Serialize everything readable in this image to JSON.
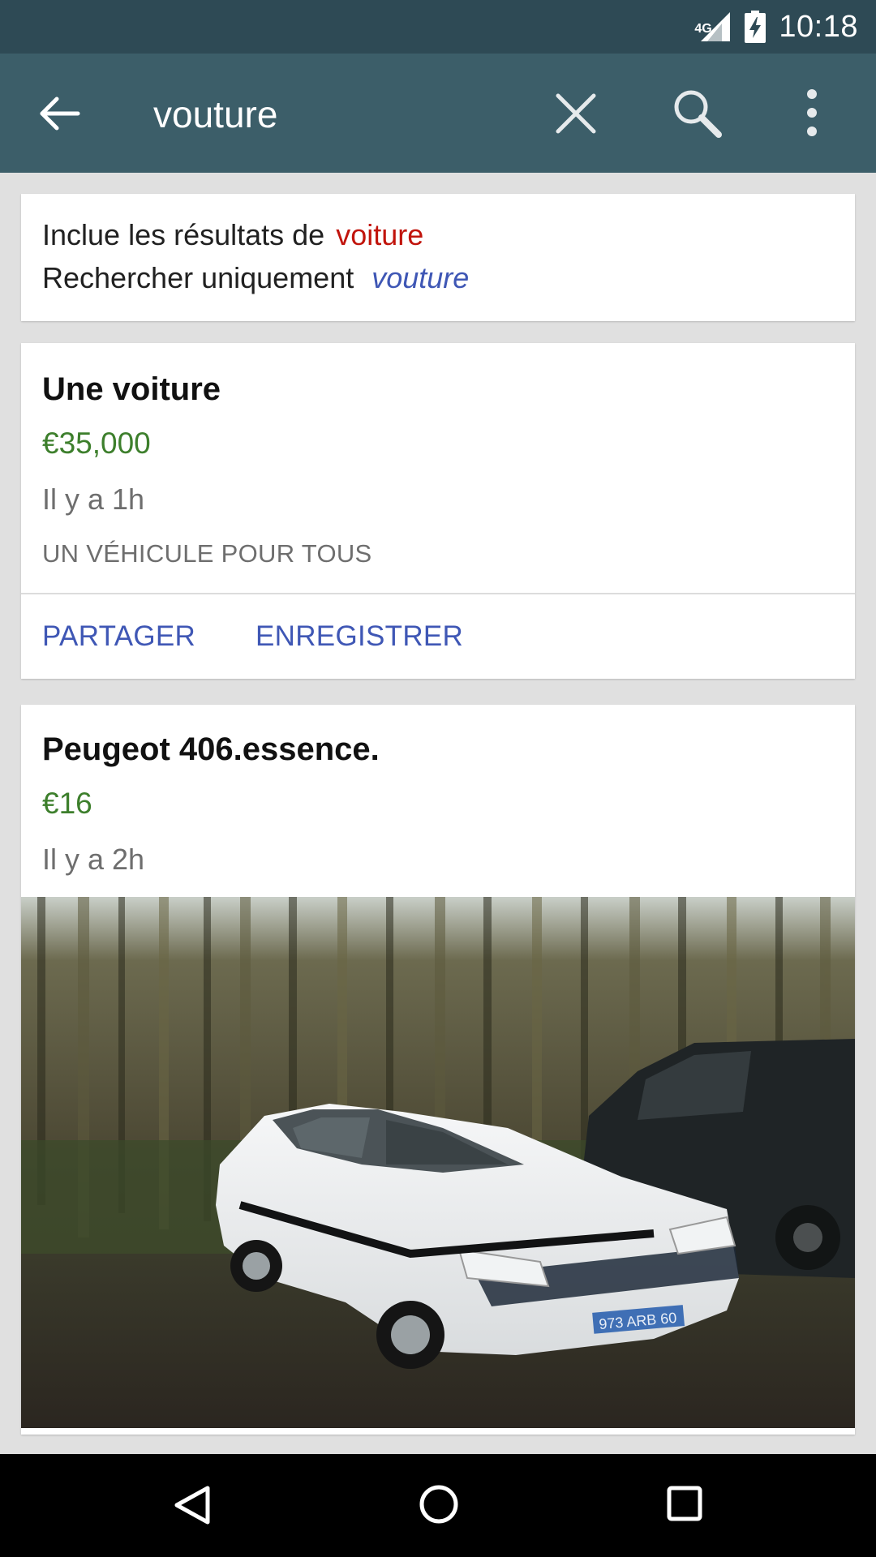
{
  "status_bar": {
    "time": "10:18",
    "network": "4G"
  },
  "app_bar": {
    "query": "vouture",
    "icons": {
      "back": "arrow-back-icon",
      "clear": "close-icon",
      "search": "search-icon",
      "more": "more-vert-icon"
    }
  },
  "suggestion": {
    "included_prefix": "Inclue les résultats de",
    "corrected_query": "voiture",
    "search_only_prefix": "Rechercher uniquement",
    "original_query": "vouture"
  },
  "listings": [
    {
      "title": "Une voiture",
      "price": "€35,000",
      "time": "Il y a 1h",
      "tagline": "UN VÉHICULE POUR TOUS",
      "actions": {
        "share": "PARTAGER",
        "save": "ENREGISTRER"
      }
    },
    {
      "title": "Peugeot 406.essence.",
      "price": "€16",
      "time": "Il y a 2h",
      "plate": "973 ARB 60"
    }
  ],
  "colors": {
    "status_bar": "#2e4a55",
    "app_bar": "#3c5e69",
    "price": "#3d7f2c",
    "link": "#3f57b5",
    "corrected": "#c1140c"
  },
  "nav_bar": {
    "icons": [
      "nav-back-icon",
      "nav-home-icon",
      "nav-recents-icon"
    ]
  }
}
